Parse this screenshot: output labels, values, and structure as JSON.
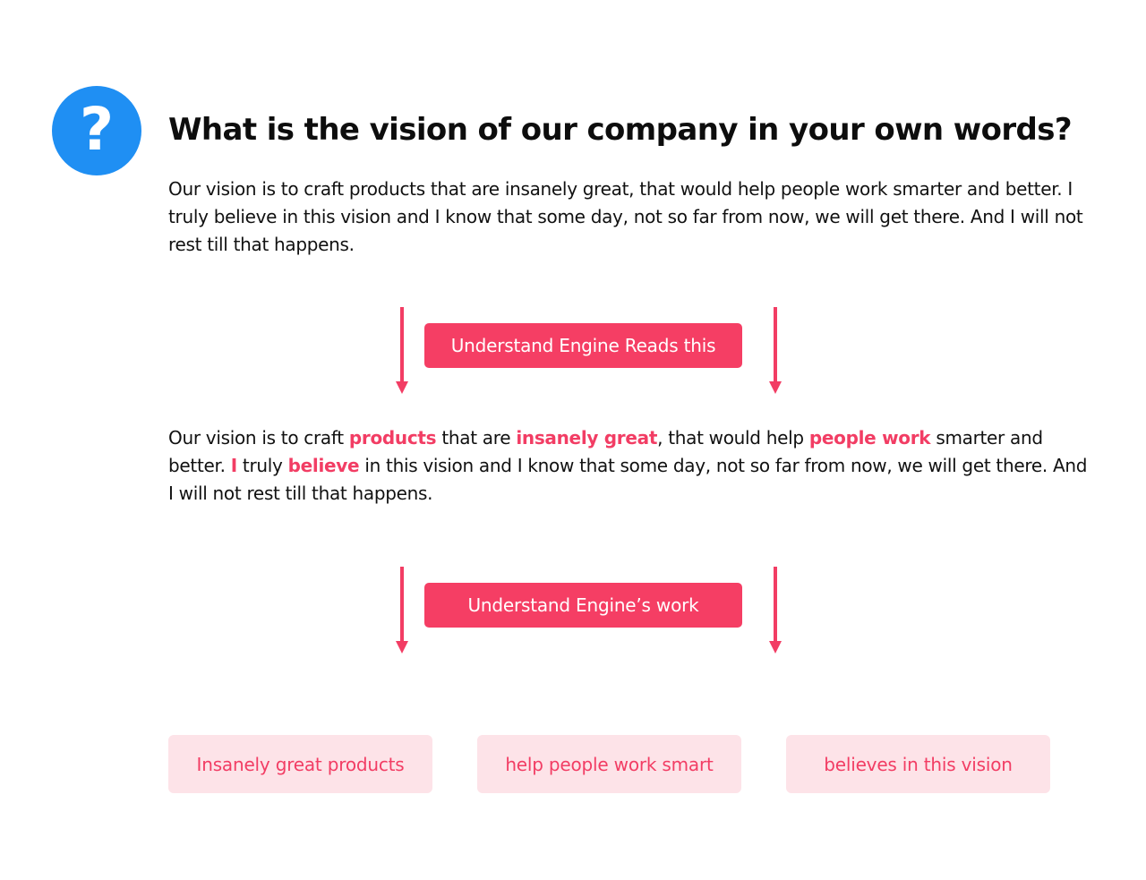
{
  "question_icon": "question-mark-icon",
  "question_glyph": "?",
  "question": "What is the vision of our company in your own words?",
  "answer": "Our vision is to craft products that are insanely great, that would help people work smarter and better. I truly believe in this vision and I know that some day, not so far from now, we will get there. And I will not rest till that happens.",
  "highlighted_answer": {
    "segments": [
      {
        "text": "Our vision is to craft ",
        "highlight": false
      },
      {
        "text": "products",
        "highlight": true
      },
      {
        "text": " that are ",
        "highlight": false
      },
      {
        "text": "insanely great",
        "highlight": true
      },
      {
        "text": ", that would help ",
        "highlight": false
      },
      {
        "text": "people work",
        "highlight": true
      },
      {
        "text": " smarter and better. ",
        "highlight": false
      },
      {
        "text": "I",
        "highlight": true
      },
      {
        "text": " truly ",
        "highlight": false
      },
      {
        "text": "believe",
        "highlight": true
      },
      {
        "text": " in this vision and I know that some day, not so far from now, we will get there. And I will not rest till that happens.",
        "highlight": false
      }
    ]
  },
  "stages": [
    {
      "label": "Understand Engine Reads this"
    },
    {
      "label": "Understand Engine’s work"
    }
  ],
  "results": [
    {
      "label": "Insanely great products"
    },
    {
      "label": "help people work smart"
    },
    {
      "label": "believes in this vision"
    }
  ],
  "colors": {
    "accent": "#f23d64",
    "accent_soft": "#fde3e8",
    "icon_blue": "#1f8ff3",
    "text": "#111111"
  }
}
